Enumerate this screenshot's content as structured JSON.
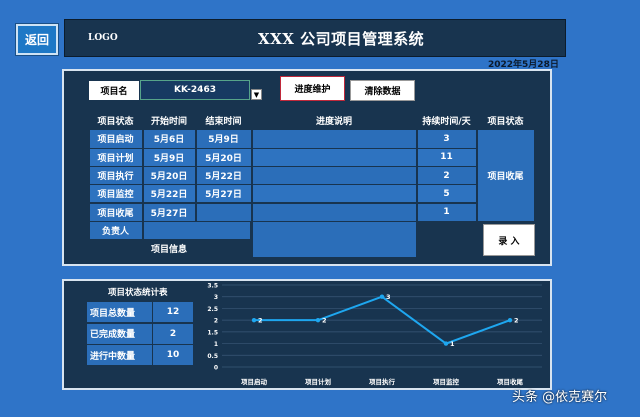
{
  "back_label": "返回",
  "logo_text": "LOGO",
  "app_title": "XXX 公司项目管理系统",
  "date": "2022年5月28日",
  "project": {
    "label": "项目名",
    "value": "KK-2463"
  },
  "buttons": {
    "progress": "进度维护",
    "clear": "清除数据",
    "enter": "录 入"
  },
  "table": {
    "headers": [
      "项目状态",
      "开始时间",
      "结束时间",
      "进度说明",
      "持续时间/天",
      "项目状态"
    ],
    "rows": [
      {
        "stage": "项目启动",
        "start": "5月6日",
        "end": "5月9日",
        "desc": "",
        "days": "3"
      },
      {
        "stage": "项目计划",
        "start": "5月9日",
        "end": "5月20日",
        "desc": "",
        "days": "11"
      },
      {
        "stage": "项目执行",
        "start": "5月20日",
        "end": "5月22日",
        "desc": "",
        "days": "2"
      },
      {
        "stage": "项目监控",
        "start": "5月22日",
        "end": "5月27日",
        "desc": "",
        "days": "5"
      },
      {
        "stage": "项目收尾",
        "start": "5月27日",
        "end": "",
        "desc": "",
        "days": "1"
      }
    ],
    "status_value": "项目收尾",
    "owner_label": "负责人",
    "info_label": "项目信息"
  },
  "stats": {
    "title": "项目状态统计表",
    "rows": [
      {
        "label": "项目总数量",
        "value": "12"
      },
      {
        "label": "已完成数量",
        "value": "2"
      },
      {
        "label": "进行中数量",
        "value": "10"
      }
    ]
  },
  "chart_data": {
    "type": "line",
    "categories": [
      "项目启动",
      "项目计划",
      "项目执行",
      "项目监控",
      "项目收尾"
    ],
    "values": [
      2,
      2,
      3,
      1,
      2
    ],
    "ylim": [
      0,
      3.5
    ],
    "yticks": [
      "0",
      "0.5",
      "1",
      "1.5",
      "2",
      "2.5",
      "3",
      "3.5"
    ],
    "grid": true,
    "line_color": "#1ea7f0"
  },
  "watermark": "头条 @依克赛尔"
}
